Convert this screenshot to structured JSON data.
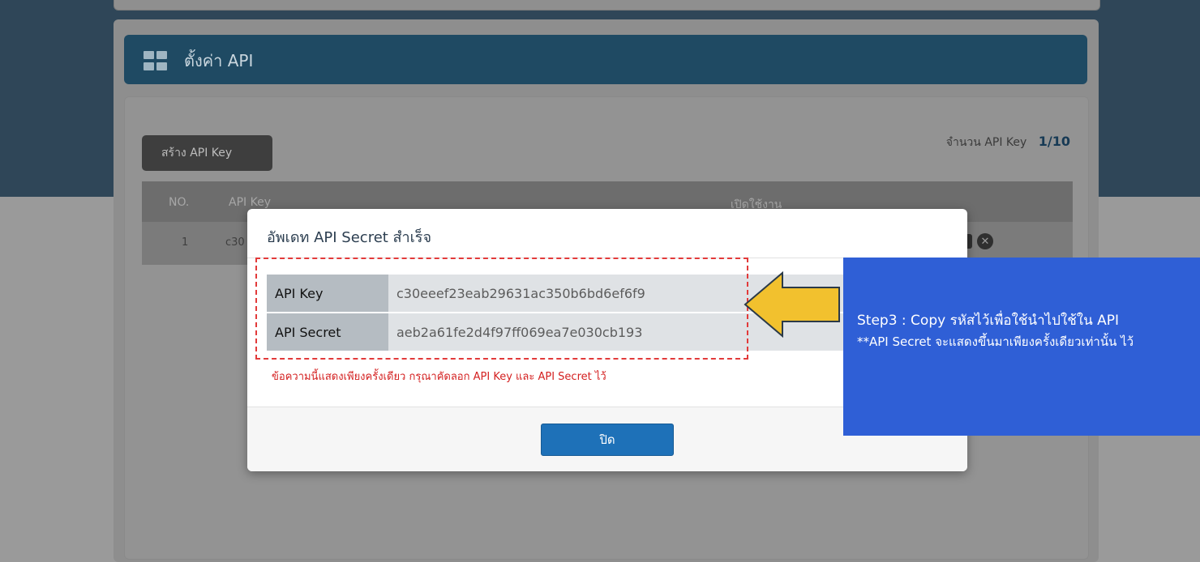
{
  "panel": {
    "title": "ตั้งค่า API",
    "icon": "grid-icon"
  },
  "toolbar": {
    "create_label": "สร้าง API Key",
    "count_label": "จำนวน API Key",
    "count_value": "1/10"
  },
  "table": {
    "headers": [
      "NO.",
      "API Key",
      "เปิดใช้งาน"
    ],
    "rows": [
      {
        "no": "1",
        "key": "c30"
      }
    ]
  },
  "modal": {
    "title": "อัพเดท API Secret สำเร็จ",
    "api_key_label": "API Key",
    "api_key_value": "c30eeef23eab29631ac350b6bd6ef6f9",
    "api_secret_label": "API Secret",
    "api_secret_value": "aeb2a61fe2d4f97ff069ea7e030cb193",
    "warning": "ข้อความนี้แสดงเพียงครั้งเดียว กรุณาคัดลอก API Key และ API Secret ไว้",
    "close_label": "ปิด"
  },
  "callout": {
    "line1": "Step3 : Copy รหัสไว้เพื่อใช้นำไปใช้ใน API",
    "line2": "**API Secret จะแสดงขึ้นมาเพียงครั้งเดียวเท่านั้น ไว้"
  },
  "colors": {
    "header_bg": "#1f4a63",
    "primary_button": "#1e71b8",
    "warning_text": "#d42020",
    "highlight_border": "#e23a3a",
    "callout_bg": "#2f5fd6",
    "arrow_fill": "#f2c12e"
  }
}
